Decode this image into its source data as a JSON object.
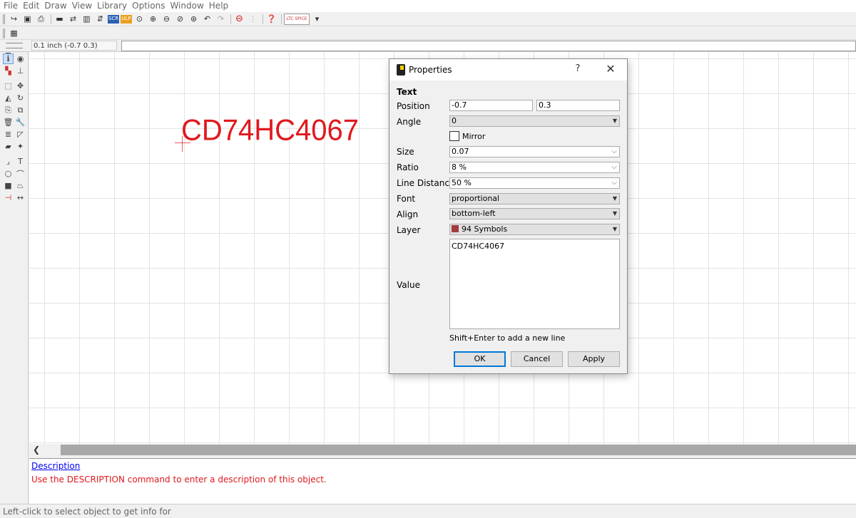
{
  "menubar": {
    "items": [
      "File",
      "Edit",
      "Draw",
      "View",
      "Library",
      "Options",
      "Window",
      "Help"
    ]
  },
  "toolbar": {
    "badge_scr": "SCR",
    "badge_ulp": "ULP",
    "logo_line1": "LTC",
    "logo_line2": "SPICE"
  },
  "coordbar": {
    "grid_coordinates": "0.1 inch (-0.7 0.3)",
    "command_value": ""
  },
  "canvas": {
    "symbol_text": "CD74HC4067",
    "text_color": "#e0191e"
  },
  "description_panel": {
    "link_label": "Description",
    "message": "Use the DESCRIPTION command to enter a description of this object."
  },
  "statusbar": {
    "message": "Left-click to select object to get info for"
  },
  "dialog": {
    "title": "Properties",
    "help": "?",
    "close": "✕",
    "section": "Text",
    "position": {
      "label": "Position",
      "x": "-0.7",
      "y": "0.3"
    },
    "angle": {
      "label": "Angle",
      "value": "0"
    },
    "mirror": {
      "label": "Mirror",
      "checked": false
    },
    "size": {
      "label": "Size",
      "value": "0.07"
    },
    "ratio": {
      "label": "Ratio",
      "value": "8 %"
    },
    "line_distance": {
      "label": "Line Distance",
      "value": "50 %"
    },
    "font": {
      "label": "Font",
      "value": "proportional"
    },
    "align": {
      "label": "Align",
      "value": "bottom-left"
    },
    "layer": {
      "label": "Layer",
      "value": "94 Symbols",
      "color": "#a33c3c"
    },
    "value": {
      "label": "Value",
      "text": "CD74HC4067"
    },
    "hint": "Shift+Enter to add a new line",
    "buttons": {
      "ok": "OK",
      "cancel": "Cancel",
      "apply": "Apply"
    }
  }
}
